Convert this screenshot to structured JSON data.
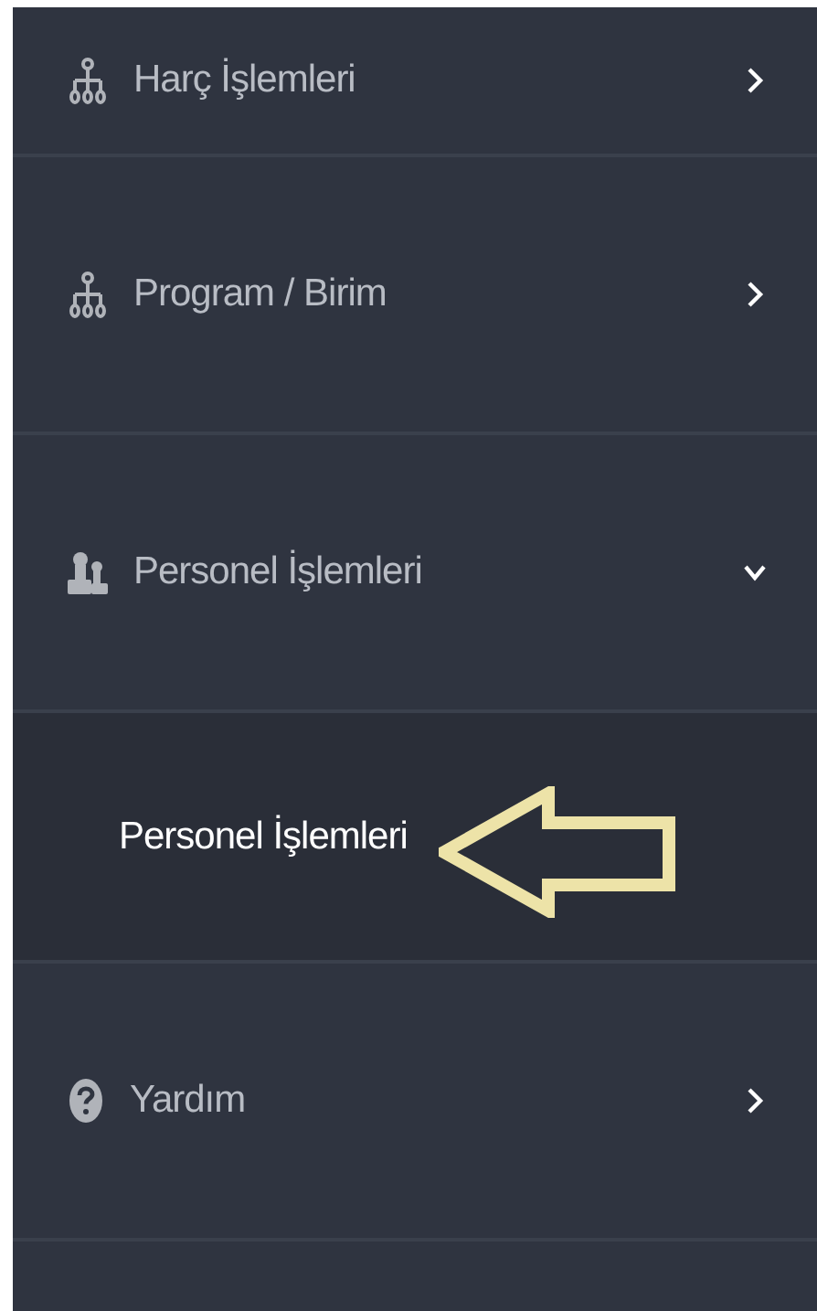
{
  "menu": [
    {
      "label": "Harç İşlemleri",
      "expanded": false
    },
    {
      "label": "Program / Birim",
      "expanded": false
    },
    {
      "label": "Personel İşlemleri",
      "expanded": true,
      "children": [
        {
          "label": "Personel İşlemleri",
          "selected": true
        }
      ]
    },
    {
      "label": "Yardım",
      "expanded": false
    }
  ]
}
